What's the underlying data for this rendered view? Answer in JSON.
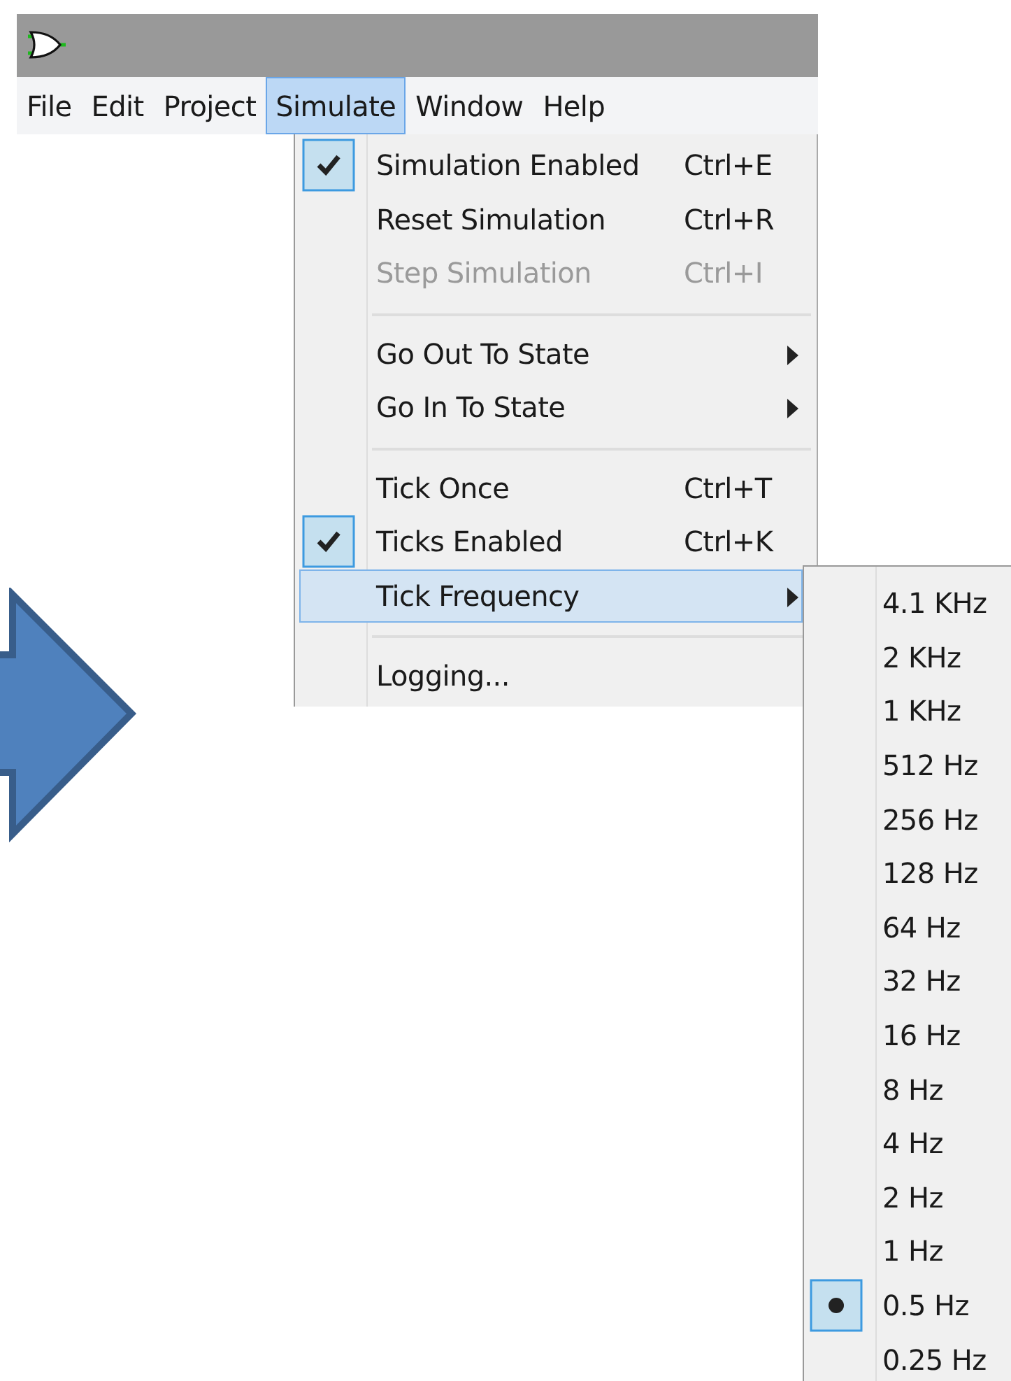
{
  "menubar": [
    {
      "label": "File",
      "selected": false
    },
    {
      "label": "Edit",
      "selected": false
    },
    {
      "label": "Project",
      "selected": false
    },
    {
      "label": "Simulate",
      "selected": true
    },
    {
      "label": "Window",
      "selected": false
    },
    {
      "label": "Help",
      "selected": false
    }
  ],
  "menu": {
    "items": [
      {
        "kind": "item",
        "label": "Simulation Enabled",
        "shortcut": "Ctrl+E",
        "checked": true,
        "disabled": false,
        "submenu": false,
        "selected": false
      },
      {
        "kind": "item",
        "label": "Reset Simulation",
        "shortcut": "Ctrl+R",
        "checked": false,
        "disabled": false,
        "submenu": false,
        "selected": false
      },
      {
        "kind": "item",
        "label": "Step Simulation",
        "shortcut": "Ctrl+I",
        "checked": false,
        "disabled": true,
        "submenu": false,
        "selected": false
      },
      {
        "kind": "separator"
      },
      {
        "kind": "item",
        "label": "Go Out To State",
        "checked": false,
        "disabled": false,
        "submenu": true,
        "selected": false
      },
      {
        "kind": "item",
        "label": "Go In To State",
        "checked": false,
        "disabled": false,
        "submenu": true,
        "selected": false
      },
      {
        "kind": "separator"
      },
      {
        "kind": "item",
        "label": "Tick Once",
        "shortcut": "Ctrl+T",
        "checked": false,
        "disabled": false,
        "submenu": false,
        "selected": false
      },
      {
        "kind": "item",
        "label": "Ticks Enabled",
        "shortcut": "Ctrl+K",
        "checked": true,
        "disabled": false,
        "submenu": false,
        "selected": false
      },
      {
        "kind": "item",
        "label": "Tick Frequency",
        "checked": false,
        "disabled": false,
        "submenu": true,
        "selected": true
      },
      {
        "kind": "separator"
      },
      {
        "kind": "item",
        "label": "Logging...",
        "checked": false,
        "disabled": false,
        "submenu": false,
        "selected": false
      }
    ]
  },
  "submenu": {
    "items": [
      {
        "label": "4.1 KHz",
        "selected": false
      },
      {
        "label": "2 KHz",
        "selected": false
      },
      {
        "label": "1 KHz",
        "selected": false
      },
      {
        "label": "512 Hz",
        "selected": false
      },
      {
        "label": "256 Hz",
        "selected": false
      },
      {
        "label": "128 Hz",
        "selected": false
      },
      {
        "label": "64 Hz",
        "selected": false
      },
      {
        "label": "32 Hz",
        "selected": false
      },
      {
        "label": "16 Hz",
        "selected": false
      },
      {
        "label": "8 Hz",
        "selected": false
      },
      {
        "label": "4 Hz",
        "selected": false
      },
      {
        "label": "2 Hz",
        "selected": false
      },
      {
        "label": "1 Hz",
        "selected": false
      },
      {
        "label": "0.5 Hz",
        "selected": true
      },
      {
        "label": "0.25 Hz",
        "selected": false
      }
    ]
  }
}
